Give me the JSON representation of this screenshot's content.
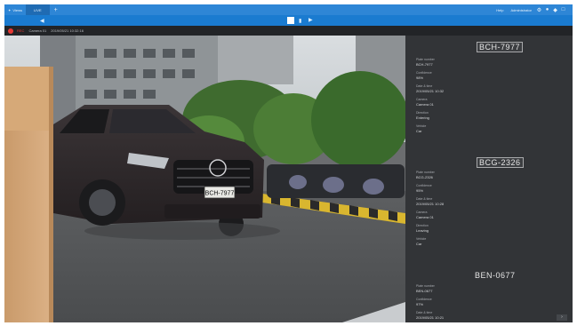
{
  "topbar": {
    "app_name": "Views",
    "tab_label": "LIVE",
    "add_tab": "+",
    "right_text_1": "Help",
    "right_text_2": "Administrator"
  },
  "toolbar": {
    "back_glyph": "◀",
    "layout_glyph": "▮",
    "next_glyph": "▶"
  },
  "camera_header": {
    "rec_label": "REC",
    "camera_name": "Camera 01",
    "timestamp": "2019/05/21 10:32:16"
  },
  "car_plate": "BCH-7977",
  "records": [
    {
      "plate": "BCH-7977",
      "fields": [
        {
          "label": "Plate number",
          "value": "BCH-7977"
        },
        {
          "label": "Confidence",
          "value": "98%"
        },
        {
          "label": "Date & time",
          "value": "2019/05/21 10:32"
        },
        {
          "label": "Camera",
          "value": "Camera 01"
        },
        {
          "label": "Direction",
          "value": "Entering"
        },
        {
          "label": "Vehicle",
          "value": "Car"
        }
      ]
    },
    {
      "plate": "BCG-2326",
      "fields": [
        {
          "label": "Plate number",
          "value": "BCG-2326"
        },
        {
          "label": "Confidence",
          "value": "95%"
        },
        {
          "label": "Date & time",
          "value": "2019/05/21 10:28"
        },
        {
          "label": "Camera",
          "value": "Camera 01"
        },
        {
          "label": "Direction",
          "value": "Leaving"
        },
        {
          "label": "Vehicle",
          "value": "Car"
        }
      ]
    },
    {
      "plate": "BEN-0677",
      "fields": [
        {
          "label": "Plate number",
          "value": "BEN-0677"
        },
        {
          "label": "Confidence",
          "value": "97%"
        },
        {
          "label": "Date & time",
          "value": "2019/05/21 10:21"
        }
      ]
    }
  ],
  "panel_more": "›",
  "colors": {
    "topbar": "#2e86d6",
    "toolbar": "#1a7bd0",
    "panel": "#323437",
    "rec": "#e53935"
  }
}
